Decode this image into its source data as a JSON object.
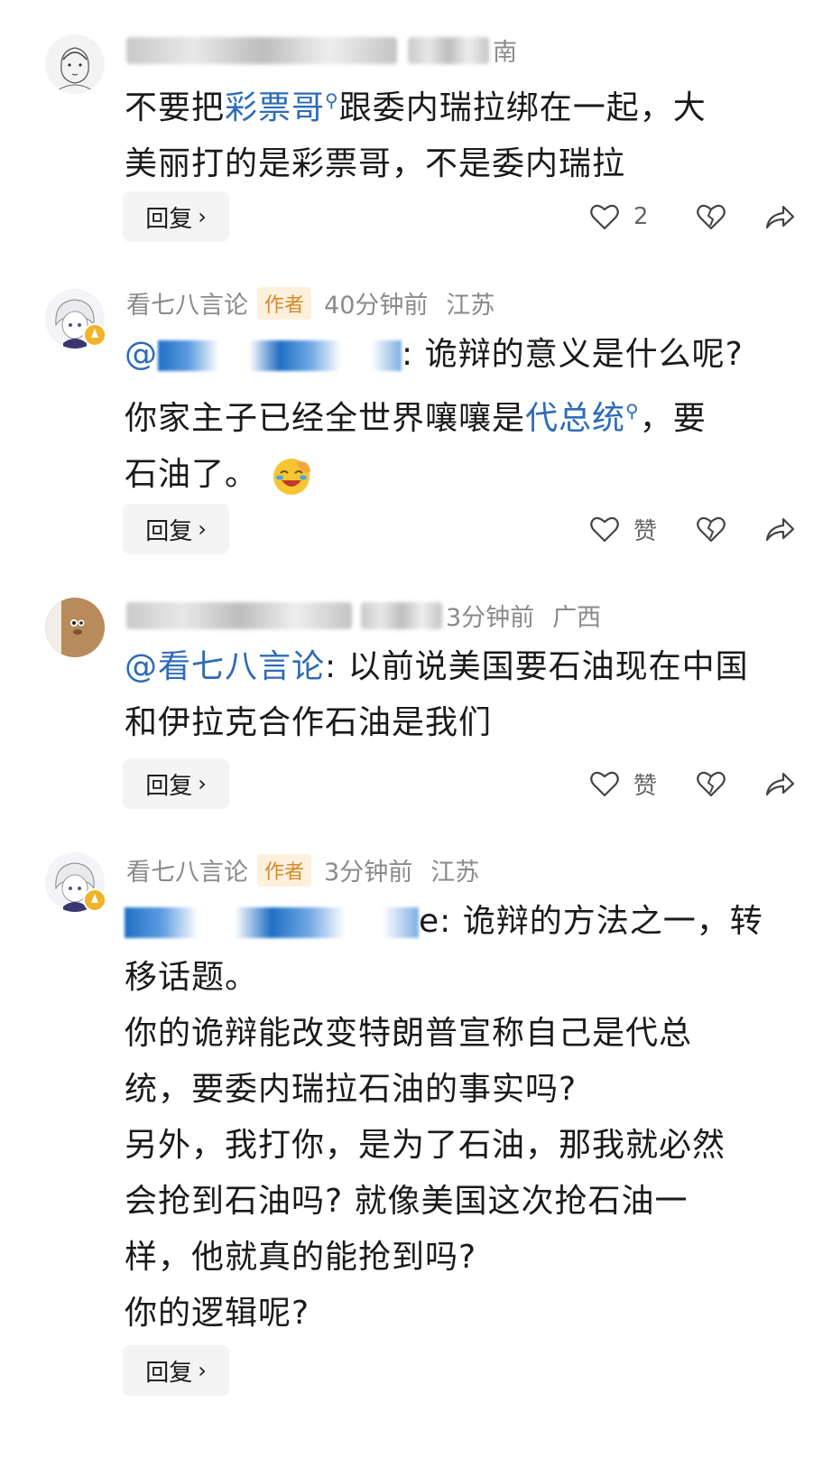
{
  "comments": [
    {
      "name": "",
      "time": "",
      "location": "南",
      "is_author": false,
      "lines": [
        {
          "parts": [
            {
              "t": "不要把"
            },
            {
              "t": "彩票哥",
              "link": true
            },
            {
              "t": "跟委内瑞拉绑在一起，大"
            }
          ]
        },
        {
          "parts": [
            {
              "t": "美丽打的是彩票哥，不是委内瑞拉"
            }
          ]
        }
      ],
      "reply_label": "回复",
      "like_count": "2"
    },
    {
      "name": "看七八言论",
      "author_tag": "作者",
      "time": "40分钟前",
      "location": "江苏",
      "is_author": true,
      "lines": [
        {
          "parts": [
            {
              "t": "@",
              "mention": true
            },
            {
              "t": ": 诡辩的意义是什么呢?"
            }
          ]
        },
        {
          "parts": [
            {
              "t": "你家主子已经全世界嚷嚷是"
            },
            {
              "t": "代总统",
              "link": true
            },
            {
              "t": "，要"
            }
          ]
        },
        {
          "parts": [
            {
              "t": "石油了。"
            }
          ],
          "emoji": "facepalm-laugh"
        }
      ],
      "reply_label": "回复",
      "like_count": "赞"
    },
    {
      "name": "",
      "time": "3分钟前",
      "location": "广西",
      "is_author": false,
      "lines": [
        {
          "parts": [
            {
              "t": "@看七八言论",
              "mention": true
            },
            {
              "t": ": 以前说美国要石油现在中国"
            }
          ]
        },
        {
          "parts": [
            {
              "t": "和伊拉克合作石油是我们"
            }
          ]
        }
      ],
      "reply_label": "回复",
      "like_count": "赞"
    },
    {
      "name": "看七八言论",
      "author_tag": "作者",
      "time": "3分钟前",
      "location": "江苏",
      "is_author": true,
      "lines": [
        {
          "parts": [
            {
              "t": "e: 诡辩的方法之一，转"
            }
          ]
        },
        {
          "parts": [
            {
              "t": "移话题。"
            }
          ]
        },
        {
          "parts": [
            {
              "t": "你的诡辩能改变特朗普宣称自己是代总"
            }
          ]
        },
        {
          "parts": [
            {
              "t": "统，要委内瑞拉石油的事实吗?"
            }
          ]
        },
        {
          "parts": [
            {
              "t": "另外，我打你，是为了石油，那我就必然"
            }
          ]
        },
        {
          "parts": [
            {
              "t": "会抢到石油吗? 就像美国这次抢石油一"
            }
          ]
        },
        {
          "parts": [
            {
              "t": "样，他就真的能抢到吗?"
            }
          ]
        },
        {
          "parts": [
            {
              "t": "你的逻辑呢?"
            }
          ]
        }
      ],
      "reply_label": "回复"
    }
  ],
  "colors": {
    "link": "#2d6bb8",
    "author_tag_bg": "#fdf0dd",
    "author_tag_text": "#d58a2e",
    "badge": "#f0b329"
  },
  "icons": [
    "heart-outline-icon",
    "broken-heart-icon",
    "share-arrow-icon",
    "search-icon",
    "chevron-right-icon"
  ]
}
